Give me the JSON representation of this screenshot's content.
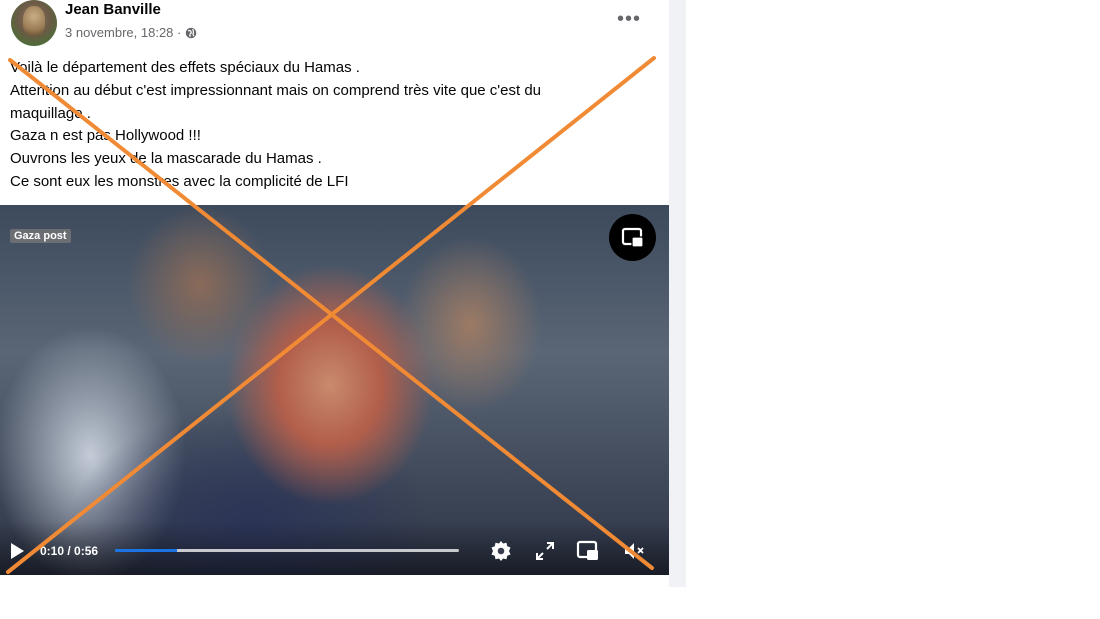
{
  "post": {
    "author": "Jean Banville",
    "date": "3 novembre, 18:28 ·",
    "more_label": "•••",
    "caption_lines": [
      "Voilà le département des effets spéciaux du Hamas  .",
      "Attention au début c'est impressionnant mais on comprend très vite que c'est du",
      "maquillage  .",
      "Gaza n est pas Hollywood !!!",
      "Ouvrons les yeux de la mascarade du Hamas  .",
      "Ce sont eux les monstres avec la complicité de LFI"
    ]
  },
  "video": {
    "watermark": "Gaza post",
    "time": "0:10 / 0:56",
    "progress_fraction": 0.18,
    "accent": "#1b74e4",
    "icons": [
      "picture-in-picture-icon",
      "play-icon",
      "settings-icon",
      "fullscreen-icon",
      "miniplayer-icon",
      "mute-icon"
    ]
  },
  "overlay": {
    "color": "#f08a35",
    "shape": "cross"
  }
}
